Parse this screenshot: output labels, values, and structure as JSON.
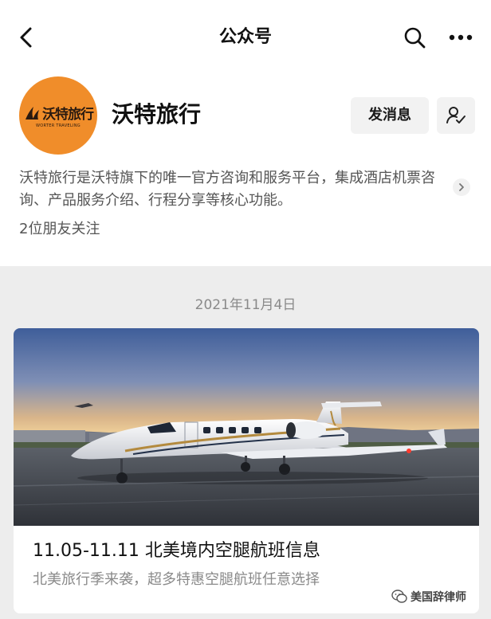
{
  "nav": {
    "title": "公众号",
    "back_icon": "back-arrow-icon",
    "search_icon": "search-icon",
    "more_icon": "more-icon"
  },
  "account": {
    "avatar_text": "沃特旅行",
    "avatar_subtext": "WORTER TRAVELING",
    "name": "沃特旅行",
    "send_message_label": "发消息",
    "follow_icon": "user-check-icon",
    "description": "沃特旅行是沃特旗下的唯一官方咨询和服务平台，集成酒店机票咨询、产品服务介绍、行程分享等核心功能。",
    "friends_following": "2位朋友关注",
    "brand_color": "#f08d2a"
  },
  "feed": {
    "date": "2021年11月4日",
    "article": {
      "title": "11.05-11.11 北美境内空腿航班信息",
      "summary": "北美旅行季来袭，超多特惠空腿航班任意选择"
    }
  },
  "watermark": {
    "text": "美国辞律师"
  }
}
